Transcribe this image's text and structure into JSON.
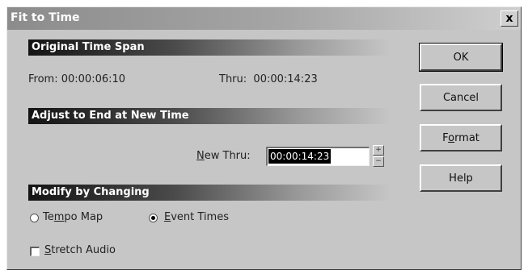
{
  "window": {
    "title": "Fit to Time",
    "close_glyph": "x"
  },
  "original_span": {
    "header": "Original Time Span",
    "from_label": "From:",
    "from_value": "00:00:06:10",
    "thru_label": "Thru:",
    "thru_value": "00:00:14:23"
  },
  "adjust": {
    "header": "Adjust to End at New Time",
    "new_thru_label_mnemonic": "N",
    "new_thru_label_rest": "ew Thru:",
    "new_thru_value": "00:00:14:23"
  },
  "modify": {
    "header": "Modify by Changing",
    "tempo_label_pre": "Te",
    "tempo_label_mnemonic": "m",
    "tempo_label_post": "po Map",
    "tempo_selected": false,
    "event_label_mnemonic": "E",
    "event_label_rest": "vent Times",
    "event_selected": true
  },
  "stretch_audio": {
    "label_mnemonic": "S",
    "label_rest": "tretch Audio",
    "checked": false
  },
  "buttons": {
    "ok": "OK",
    "cancel": "Cancel",
    "format_pre": "F",
    "format_mnemonic": "o",
    "format_post": "rmat",
    "help": "Help"
  },
  "icons": {
    "spin_up": "spin-up-icon",
    "spin_down": "spin-down-icon"
  }
}
